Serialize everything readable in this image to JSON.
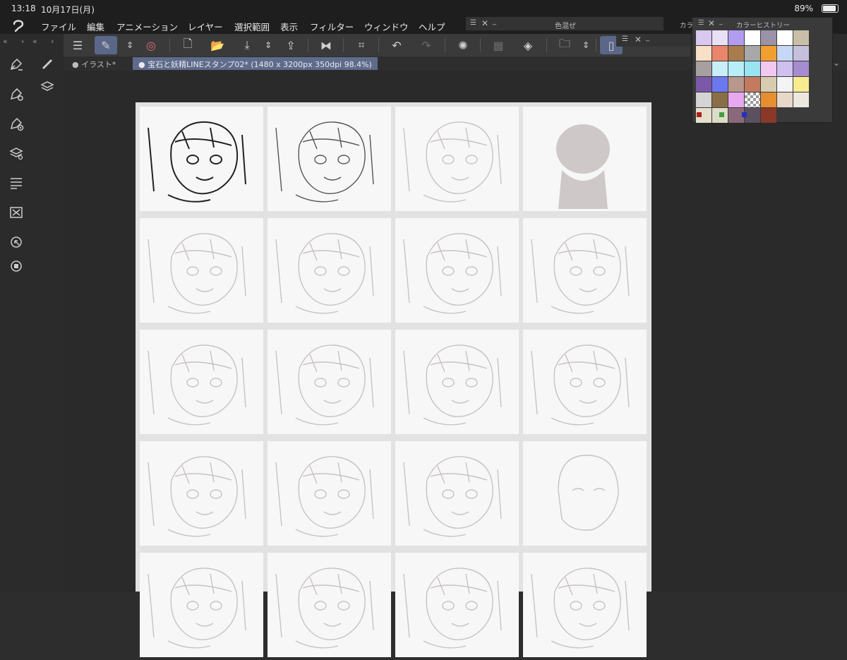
{
  "status": {
    "time": "13:18",
    "date": "10月17日(月)",
    "battery_text": "89%",
    "battery_level": 0.89
  },
  "menu": [
    "ファイル",
    "編集",
    "アニメーション",
    "レイヤー",
    "選択範囲",
    "表示",
    "フィルター",
    "ウィンドウ",
    "ヘルプ"
  ],
  "panels": {
    "color_mix_title": "色混ぜ",
    "color_tab_short": "カラ",
    "history_title": "カラーヒストリー"
  },
  "tabs": [
    {
      "label": "イラスト*",
      "active": false
    },
    {
      "label": "宝石と妖精LINEスタンプ02* (1480 x 3200px 350dpi 98.4%)",
      "active": true
    }
  ],
  "toolbar_icons": [
    "menu-icon",
    "edit-icon",
    "up-down-icon",
    "spiral-icon",
    "new-doc-icon",
    "open-folder-icon",
    "save-icon",
    "up-down-icon",
    "share-icon",
    "flip-icon",
    "transform-icon",
    "undo-icon",
    "redo-icon",
    "loading-icon",
    "fill-icon",
    "bucket-icon",
    "folder-icon",
    "up-down-icon",
    "tablet-icon"
  ],
  "history_colors": [
    "#d9c8f0",
    "#e8e0f5",
    "#b19cf0",
    "#ffffff",
    "#9b91a8",
    "#ffffff",
    "#c9bfa8",
    "#f8dfc6",
    "#e8856a",
    "#a87c4c",
    "#a8a8a8",
    "#f0a030",
    "#c6d8f5",
    "#c6c0dc",
    "#a8a0a0",
    "#c8eef8",
    "#b8eef8",
    "#98e4f2",
    "#f2c8f0",
    "#d0c0f0",
    "#a68cd0",
    "#7c58a8",
    "#6c78f0",
    "#b8978c",
    "#c47a5e",
    "#d8ccb0",
    "#f4f4f4",
    "#f8ec90",
    "#d4d4d4",
    "#8a6e48",
    "#e8a8f0",
    "checker",
    "#e88e30",
    "#e8d8c8",
    "#ece8e0",
    "#e4e0cc",
    "#dcdcc8",
    "#8a6a7a",
    "#5a5060",
    "#8a3828"
  ],
  "history_dots": [
    "#b02020",
    "#40a040",
    "#2030c0"
  ],
  "grid": {
    "rows": 5,
    "cols": 4
  }
}
